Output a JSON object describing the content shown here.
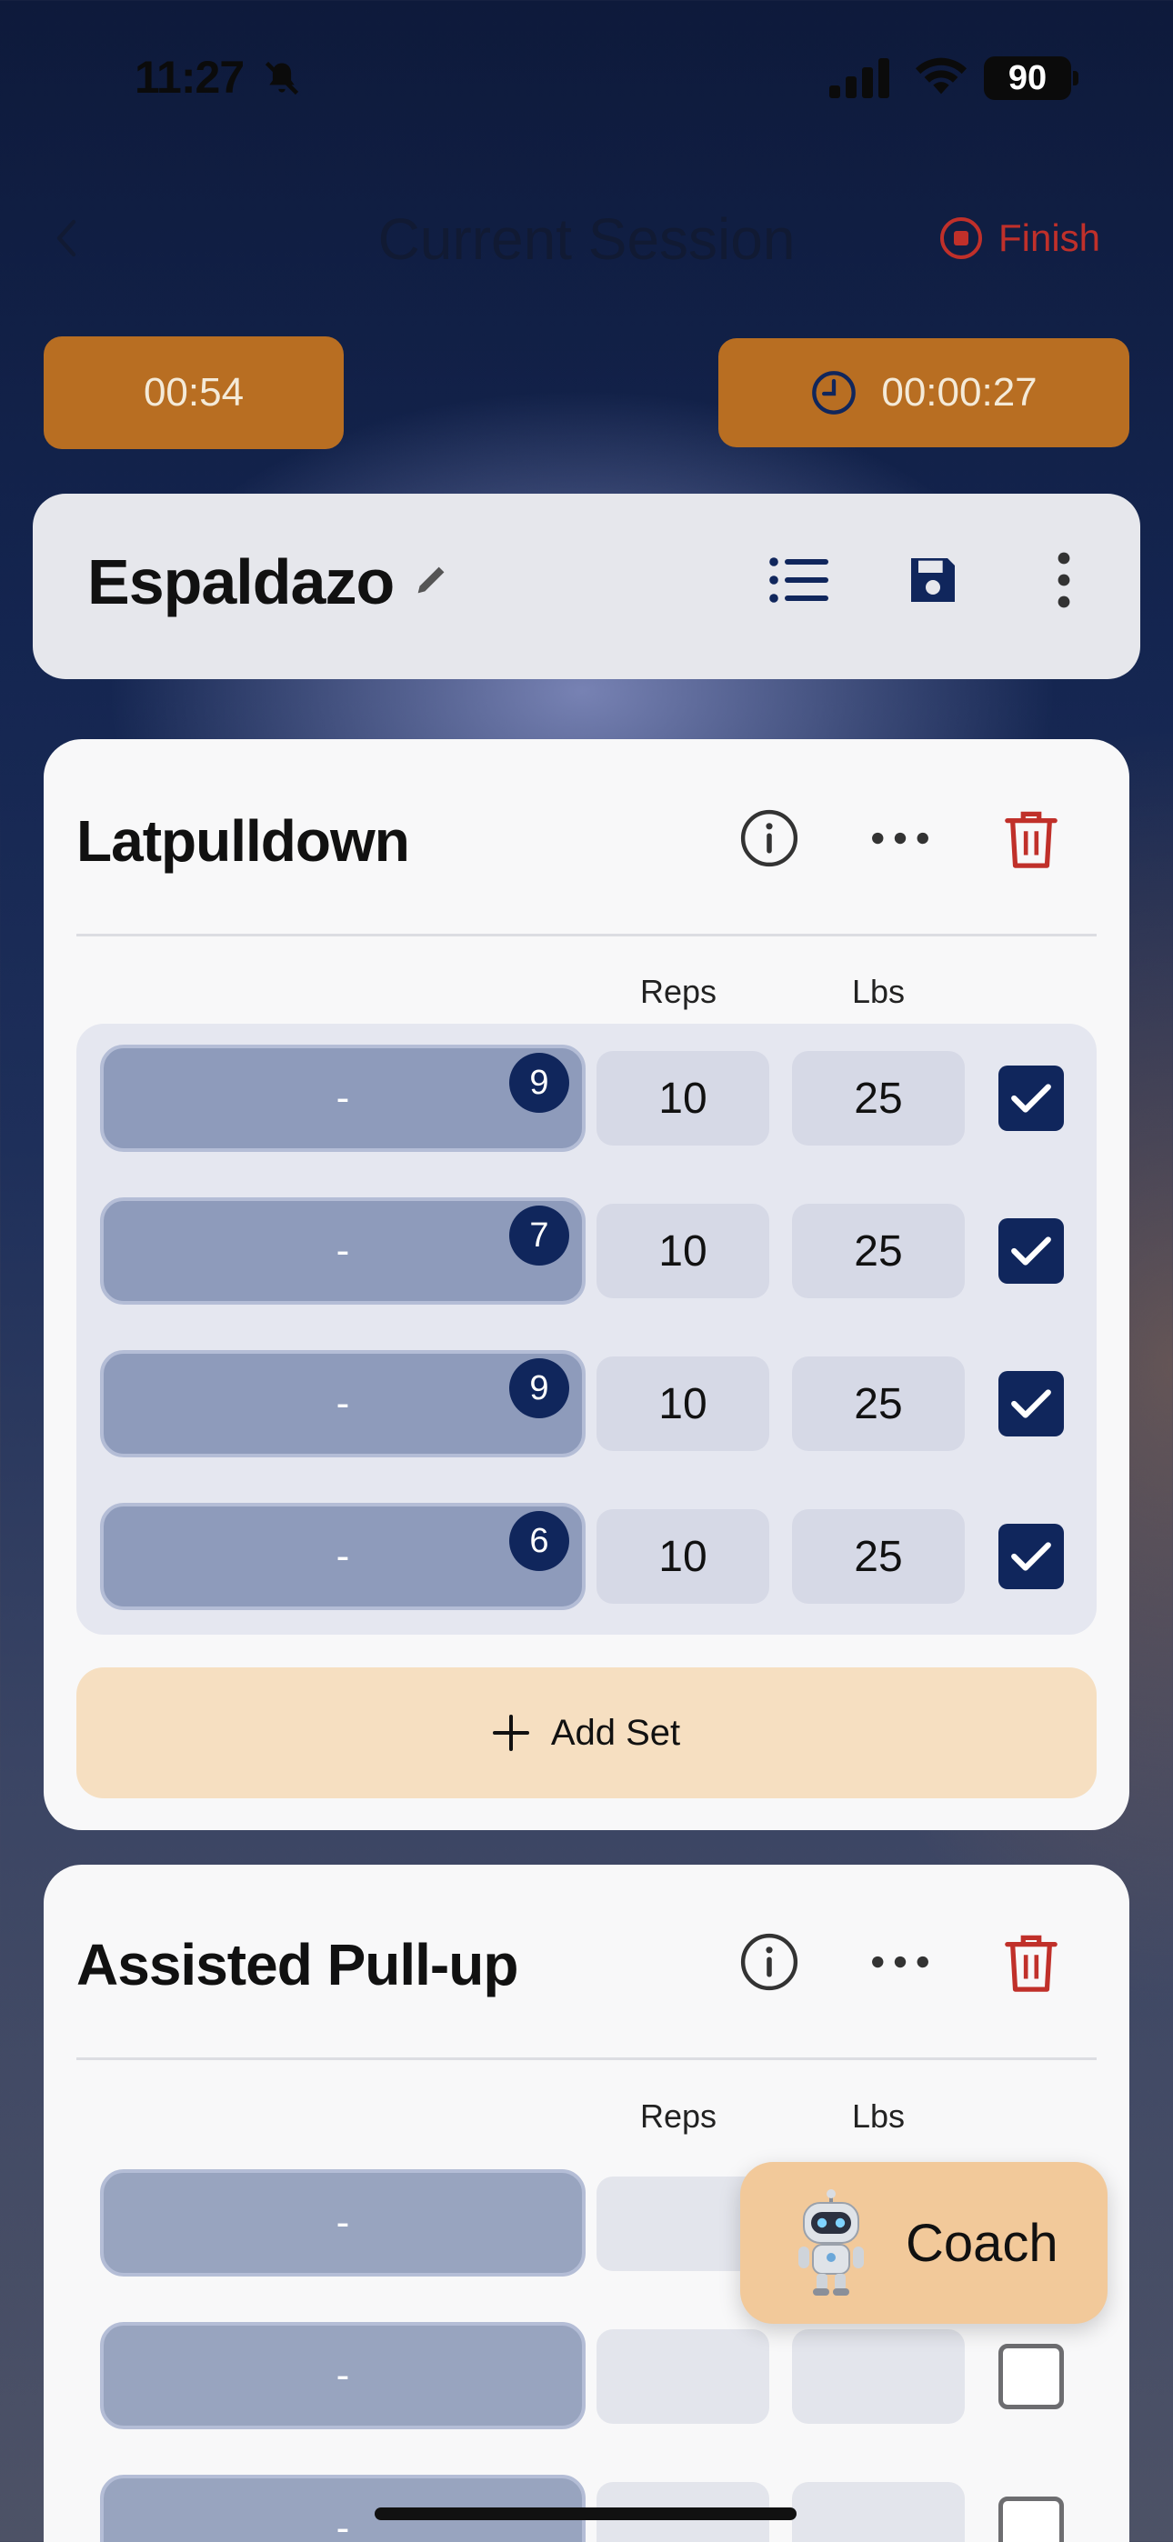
{
  "status_bar": {
    "time": "11:27",
    "battery": "90"
  },
  "header": {
    "title": "Current Session",
    "finish_label": "Finish"
  },
  "timers": {
    "rest": "00:54",
    "session": "00:00:27"
  },
  "workout": {
    "name": "Espaldazo"
  },
  "exercises": [
    {
      "name": "Latpulldown",
      "col_reps": "Reps",
      "col_lbs": "Lbs",
      "sets": [
        {
          "previous": "-",
          "rpe": "9",
          "reps": "10",
          "lbs": "25",
          "done": true
        },
        {
          "previous": "-",
          "rpe": "7",
          "reps": "10",
          "lbs": "25",
          "done": true
        },
        {
          "previous": "-",
          "rpe": "9",
          "reps": "10",
          "lbs": "25",
          "done": true
        },
        {
          "previous": "-",
          "rpe": "6",
          "reps": "10",
          "lbs": "25",
          "done": true
        }
      ],
      "add_set_label": "Add Set"
    },
    {
      "name": "Assisted Pull-up",
      "col_reps": "Reps",
      "col_lbs": "Lbs",
      "sets": [
        {
          "previous": "-",
          "reps": "",
          "lbs": "",
          "done": false
        },
        {
          "previous": "-",
          "reps": "",
          "lbs": "",
          "done": false
        },
        {
          "previous": "-",
          "reps": "",
          "lbs": "",
          "done": false
        }
      ]
    }
  ],
  "coach": {
    "label": "Coach"
  },
  "colors": {
    "accent_navy": "#10265c",
    "timer_orange": "#b86e22",
    "finish_red": "#c0302a",
    "add_set_bg": "#f6dfc1",
    "coach_bg": "#f2c99a"
  }
}
